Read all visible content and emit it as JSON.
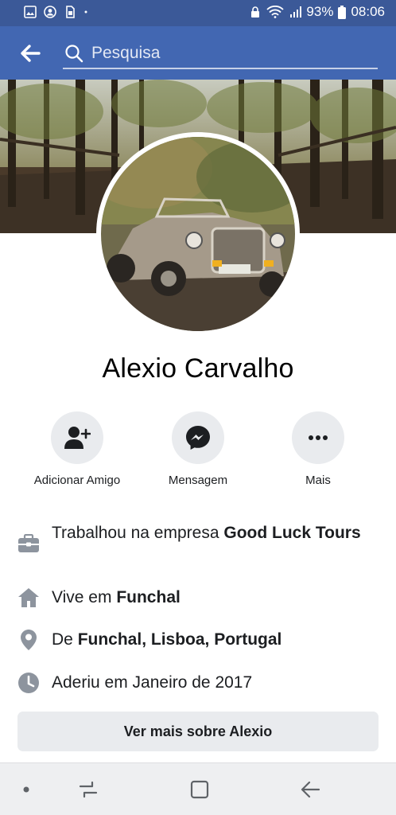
{
  "status_bar": {
    "battery": "93%",
    "time": "08:06"
  },
  "search": {
    "placeholder": "Pesquisa"
  },
  "profile": {
    "name": "Alexio Carvalho"
  },
  "actions": {
    "add_friend": "Adicionar Amigo",
    "message": "Mensagem",
    "more": "Mais"
  },
  "info": {
    "work_prefix": "Trabalhou na empresa ",
    "work_company": "Good Luck Tours",
    "lives_prefix": "Vive em ",
    "lives_city": "Funchal",
    "from_prefix": "De ",
    "from_place": "Funchal, Lisboa, Portugal",
    "joined": "Aderiu em Janeiro de 2017"
  },
  "see_more_label": "Ver mais sobre Alexio",
  "colors": {
    "brand": "#4267b2",
    "status_bar": "#3b5998",
    "button_bg": "#e9ebee",
    "icon_gray": "#8d949e"
  },
  "icons": [
    "gallery-icon",
    "account-circle-icon",
    "sim-icon",
    "lock-icon",
    "wifi-icon",
    "signal-icon",
    "battery-icon",
    "back-arrow-icon",
    "search-icon",
    "add-friend-icon",
    "messenger-icon",
    "more-dots-icon",
    "briefcase-icon",
    "home-icon",
    "location-pin-icon",
    "clock-icon",
    "recent-apps-icon",
    "home-button-icon",
    "nav-back-icon"
  ]
}
